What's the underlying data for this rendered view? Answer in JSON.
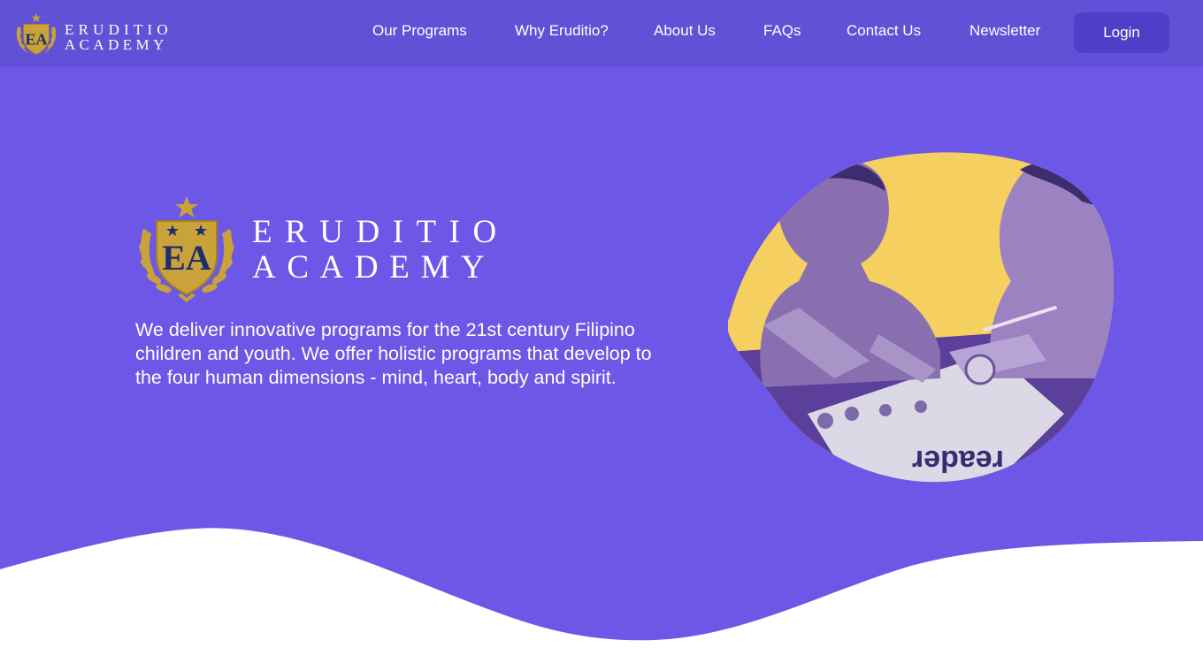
{
  "brand": {
    "monogram": "EA",
    "name_line1": "ERUDITIO",
    "name_line2": "ACADEMY",
    "logo_icon": "laurel-shield-crest-icon"
  },
  "nav": {
    "items": [
      {
        "label": "Our Programs"
      },
      {
        "label": "Why Eruditio?"
      },
      {
        "label": "About Us"
      },
      {
        "label": "FAQs"
      },
      {
        "label": "Contact Us"
      },
      {
        "label": "Newsletter"
      }
    ],
    "login_label": "Login"
  },
  "hero": {
    "description": "We deliver innovative programs for the 21st century Filipino children and youth. We offer holistic programs that develop to the four human dimensions - mind, heart, body and spirit.",
    "worksheet_text": "reader"
  },
  "colors": {
    "background": "#6c57e6",
    "navbar": "#6151d6",
    "login_button": "#4f3fc8",
    "gold": "#c9a23a",
    "shield_navy": "#1e2f6b",
    "circle_yellow": "#f5cf5f"
  }
}
